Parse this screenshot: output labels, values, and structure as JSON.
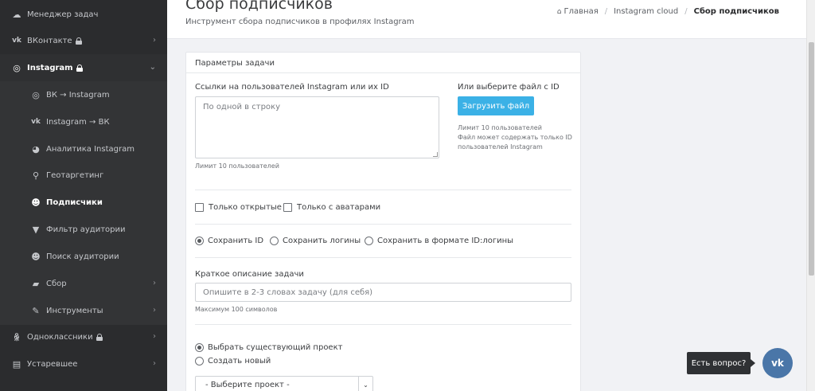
{
  "sidebar": {
    "items": [
      {
        "label": "Менеджер задач",
        "icon": "cloud-icon",
        "glyph": "☁"
      },
      {
        "label": "ВКонтакте",
        "icon": "vk-icon",
        "glyph": "vk"
      },
      {
        "label": "Instagram",
        "icon": "instagram-icon",
        "glyph": "◎"
      },
      {
        "label": "ВК → Instagram",
        "icon": "instagram-icon",
        "glyph": "◎"
      },
      {
        "label": "Instagram → ВК",
        "icon": "vk-icon",
        "glyph": "vk"
      },
      {
        "label": "Аналитика Instagram",
        "icon": "pie-chart-icon",
        "glyph": "◕"
      },
      {
        "label": "Геотаргетинг",
        "icon": "map-marker-icon",
        "glyph": "⚲"
      },
      {
        "label": "Подписчики",
        "icon": "users-icon",
        "glyph": "☻"
      },
      {
        "label": "Фильтр аудитории",
        "icon": "filter-icon",
        "glyph": "▼"
      },
      {
        "label": "Поиск аудитории",
        "icon": "users-icon",
        "glyph": "☻"
      },
      {
        "label": "Сбор",
        "icon": "truck-icon",
        "glyph": "▰"
      },
      {
        "label": "Инструменты",
        "icon": "wrench-icon",
        "glyph": "✎"
      },
      {
        "label": "Одноклассники",
        "icon": "odnoklassniki-icon",
        "glyph": "ꆜ"
      },
      {
        "label": "Устаревшее",
        "icon": "archive-icon",
        "glyph": "▤"
      }
    ]
  },
  "header": {
    "title": "Сбор подписчиков",
    "subtitle": "Инструмент сбора подписчиков в профилях Instagram",
    "breadcrumb": {
      "home": "Главная",
      "section": "Instagram cloud",
      "current": "Сбор подписчиков"
    }
  },
  "card": {
    "title": "Параметры задачи",
    "links_label": "Ссылки на пользователей Instagram или их ID",
    "links_placeholder": "По одной в строку",
    "links_hint": "Лимит 10 пользователей",
    "file_label": "Или выберите файл с ID",
    "upload_button": "Загрузить файл",
    "file_hint_1": "Лимит 10 пользователей",
    "file_hint_2": "Файл может содержать только ID",
    "file_hint_3": "пользователей Instagram",
    "checkbox_open": "Только открытые",
    "checkbox_avatars": "Только с аватарами",
    "save_options": [
      "Сохранить ID",
      "Сохранить логины",
      "Сохранить в формате ID:логины"
    ],
    "description_label": "Краткое описание задачи",
    "description_placeholder": "Опишите в 2-3 словах задачу (для себя)",
    "description_hint": "Максимум 100 символов",
    "project_options": [
      "Выбрать существующий проект",
      "Создать новый"
    ],
    "project_select": "- Выберите проект -"
  },
  "chat": {
    "question": "Есть вопрос?",
    "vk_label": "vk"
  },
  "colors": {
    "sidebar_bg": "#2b2c2e",
    "accent": "#3bb1e6",
    "vk_blue": "#4a76a8"
  }
}
